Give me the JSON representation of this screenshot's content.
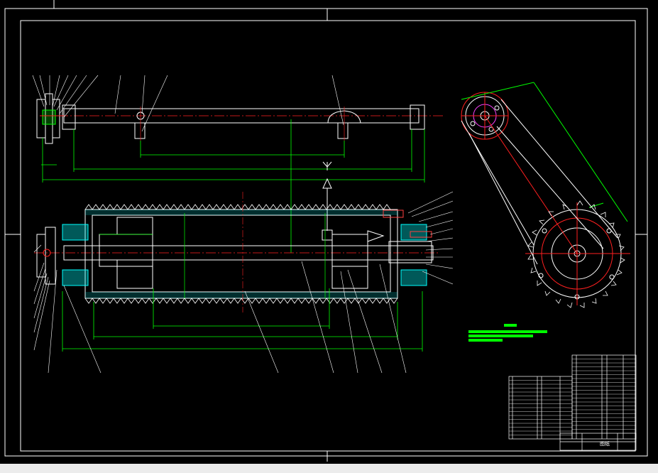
{
  "drawing": {
    "background": "#000000",
    "line_color": "#ffffff",
    "dimension_color": "#00ff00",
    "centerline_color": "#ff2020",
    "section_fill_color": "#00ffff",
    "title_block_label": "图纸"
  },
  "parts_list": {
    "left_rows": 16,
    "right_rows": 20
  },
  "statusbar": {
    "color": "#ececec"
  }
}
